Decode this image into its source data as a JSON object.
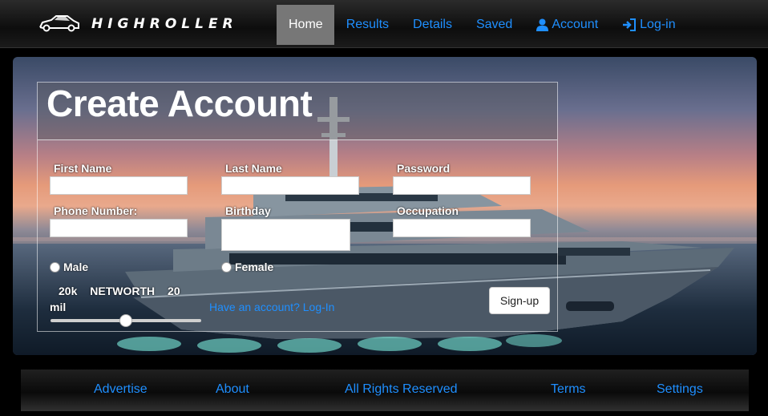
{
  "navbar": {
    "brand_text": "HIGHROLLER",
    "items": [
      {
        "label": "Home",
        "icon": ""
      },
      {
        "label": "Results",
        "icon": ""
      },
      {
        "label": "Details",
        "icon": ""
      },
      {
        "label": "Saved",
        "icon": ""
      },
      {
        "label": "Account",
        "icon": "user-icon"
      },
      {
        "label": "Log-in",
        "icon": "login-icon"
      }
    ],
    "active_item": "Home"
  },
  "form": {
    "title": "Create Account",
    "first_name_label": "First Name",
    "last_name_label": "Last Name",
    "password_label": "Password",
    "phone_label": "Phone Number:",
    "birthday_label": "Birthday",
    "occupation_label": "Occupation",
    "first_name_value": "",
    "last_name_value": "",
    "password_value": "",
    "phone_value": "",
    "birthday_value": "",
    "occupation_value": "",
    "gender_options": [
      "Male",
      "Female"
    ],
    "slider": {
      "min_label": "20k",
      "title": "NETWORTH",
      "max_label_1": "20",
      "max_label_2": "mil",
      "position_fraction": 0.5
    },
    "login_link": "Have an account? Log-In",
    "signup_button": "Sign-up"
  },
  "footer": {
    "links": [
      "Advertise",
      "About",
      "All Rights Reserved",
      "Terms",
      "Settings"
    ]
  },
  "colors": {
    "link": "#1f8fff",
    "nav_active_bg": "#777777",
    "page_bg": "#000000"
  }
}
